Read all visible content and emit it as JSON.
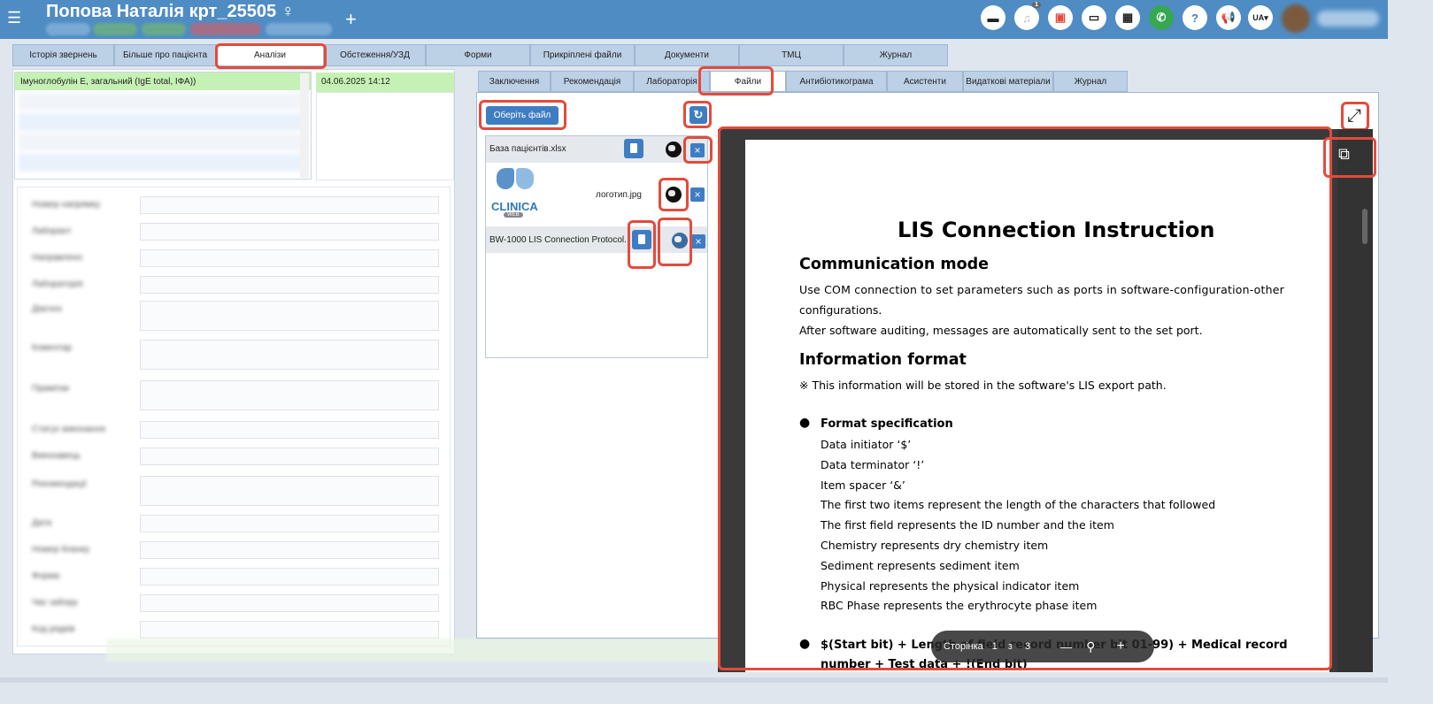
{
  "header": {
    "menu_icon": "☰",
    "patient_name": "Попова Наталія крт_25505 ♀",
    "add_label": "+",
    "lang": "UA▾",
    "icons": [
      {
        "name": "chat-icon",
        "glyph": "▬",
        "color": "#222",
        "badge": ""
      },
      {
        "name": "notification-icon",
        "glyph": "♫",
        "color": "#bbb",
        "badge": "1"
      },
      {
        "name": "pdf-icon",
        "glyph": "▣",
        "color": "#e34b3c",
        "badge": ""
      },
      {
        "name": "card-icon",
        "glyph": "▭",
        "color": "#222",
        "badge": ""
      },
      {
        "name": "calculator-icon",
        "glyph": "▦",
        "color": "#222",
        "badge": ""
      },
      {
        "name": "phone-icon",
        "glyph": "✆",
        "color": "#fff",
        "badge": ""
      },
      {
        "name": "help-icon",
        "glyph": "?",
        "color": "#3f7dc3",
        "badge": ""
      },
      {
        "name": "megaphone-icon",
        "glyph": "📢",
        "color": "#3f7dc3",
        "badge": ""
      }
    ]
  },
  "main_tabs": [
    "Історія звернень",
    "Більше про пацієнта",
    "Аналізи",
    "Обстеження/УЗД",
    "Форми",
    "Прикріплені файли",
    "Документи",
    "ТМЦ",
    "Журнал"
  ],
  "analysis": {
    "selected_test": "Імуноглобулін Е, загальний (IgE total, ІФА))",
    "date": "04.06.2025 14:12"
  },
  "form_labels": [
    "Номер напрямку",
    "Лаборант",
    "Направлено",
    "Лабораторія",
    "Діагноз",
    "Коментар",
    "Примітки",
    "Статус виконання",
    "Виконавець",
    "Рекомендації",
    "Дата",
    "Номер бланку",
    "Форма",
    "Час забору",
    "Код рядків"
  ],
  "sub_tabs": [
    "Заключення",
    "Рекомендація",
    "Лабораторія",
    "Файли",
    "Антибіотикограма",
    "Асистенти",
    "Видаткові матеріали",
    "Журнал"
  ],
  "files": {
    "choose_label": "Оберіть файл",
    "refresh_icon": "↻",
    "items": [
      "База пацієнтів.xlsx",
      "логотип.jpg",
      "BW-1000 LIS Connection Protocol."
    ],
    "logo_text": "CLINICA",
    "logo_sub": "WEB"
  },
  "viewer": {
    "expand_icon": "⤢",
    "open_icon": "⧉",
    "document": {
      "title": "LIS Connection Instruction",
      "section1": "Communication mode",
      "p1a": "Use COM connection to set parameters such as ports in software-configuration-other",
      "p1b": "configurations.",
      "p2": "After software auditing, messages are automatically sent to the set port.",
      "section2": "Information format",
      "note": "※  This information will be stored in the software's LIS export path.",
      "bullet_title": "Format specification",
      "spec_items": [
        "Data initiator ‘$’",
        "Data terminator ‘!’",
        "Item spacer ‘&’",
        "The first two items represent the length of the characters that followed",
        "The first field represents the ID number and the item",
        "Chemistry represents dry chemistry item",
        "Sediment represents sediment item",
        "Physical represents the physical indicator item",
        "RBC Phase represents the erythrocyte phase item"
      ],
      "bullet2a": "$(Start bit) + Length of field record number bit 01-99) + Medical record",
      "bullet2b": "number + Test data + !(End bit)"
    },
    "pager": {
      "label": "Сторінка",
      "current": "1",
      "sep": "з",
      "total": "3",
      "zoom_out": "—",
      "zoom_in": "+"
    }
  }
}
